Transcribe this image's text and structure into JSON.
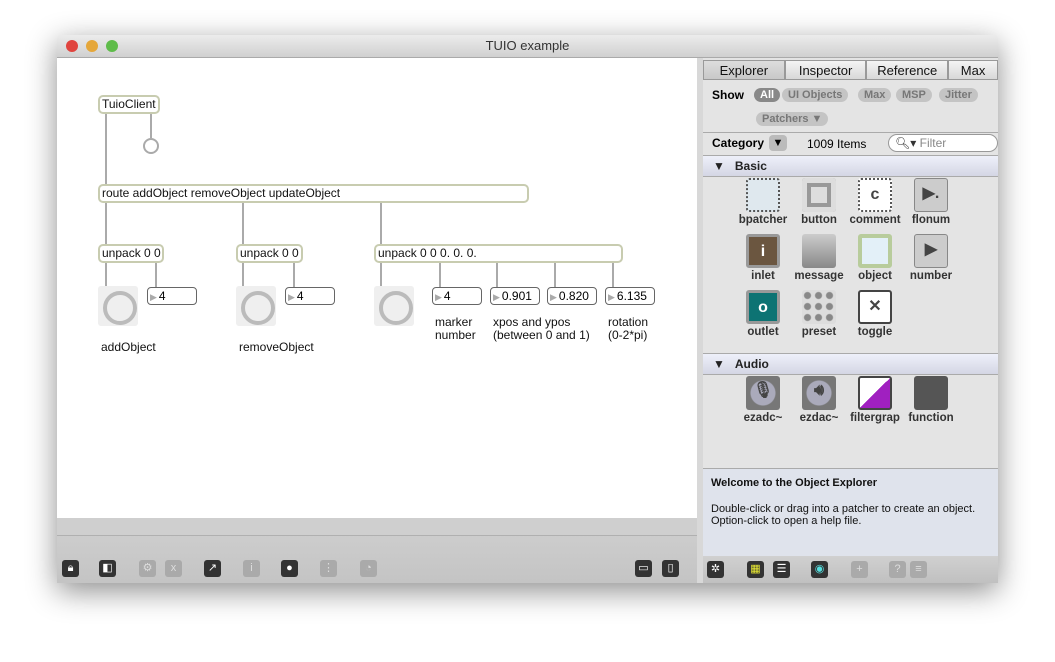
{
  "window": {
    "title": "TUIO example"
  },
  "patcher": {
    "objects": {
      "tuioclient": "TuioClient",
      "route": "route addObject removeObject updateObject",
      "unpack1": "unpack 0 0",
      "unpack2": "unpack 0 0",
      "unpack3": "unpack 0 0 0. 0. 0."
    },
    "numbers": [
      "4",
      "4",
      "4",
      "0.901",
      "0.820",
      "6.135"
    ],
    "comments": {
      "add": "addObject",
      "remove": "removeObject",
      "marker": "marker\nnumber",
      "xy": "xpos and ypos\n(between 0 and 1)",
      "rotation": "rotation\n(0-2*pi)"
    },
    "toolbar_icons": [
      "lock-icon",
      "presentation-icon",
      "debug-icon",
      "clear-icon",
      "patch-cords-icon",
      "info-icon",
      "connect-icon",
      "grid-icon",
      "snap-icon",
      "split-horizontal-icon",
      "split-vertical-icon"
    ]
  },
  "explorer": {
    "tabs": [
      "Explorer",
      "Inspector",
      "Reference",
      "Max"
    ],
    "show_label": "Show",
    "filters": [
      "All",
      "UI Objects",
      "Max",
      "MSP",
      "Jitter",
      "Patchers ▼"
    ],
    "category_label": "Category",
    "item_count": "1009 Items",
    "filter_placeholder": "Filter",
    "sections": [
      {
        "name": "Basic",
        "items": [
          "bpatcher",
          "button",
          "comment",
          "flonum",
          "inlet",
          "message",
          "object",
          "number",
          "outlet",
          "preset",
          "toggle"
        ]
      },
      {
        "name": "Audio",
        "items": [
          "ezadc~",
          "ezdac~",
          "filtergrap",
          "function"
        ]
      }
    ],
    "help_title": "Welcome to the Object Explorer",
    "help_text": "Double-click or drag into a patcher to create an object. Option-click to open a help file.",
    "toolbar_icons": [
      "settings-icon",
      "grid-view-icon",
      "list-view-icon",
      "preview-icon",
      "add-icon",
      "help-icon",
      "menu-icon"
    ]
  }
}
